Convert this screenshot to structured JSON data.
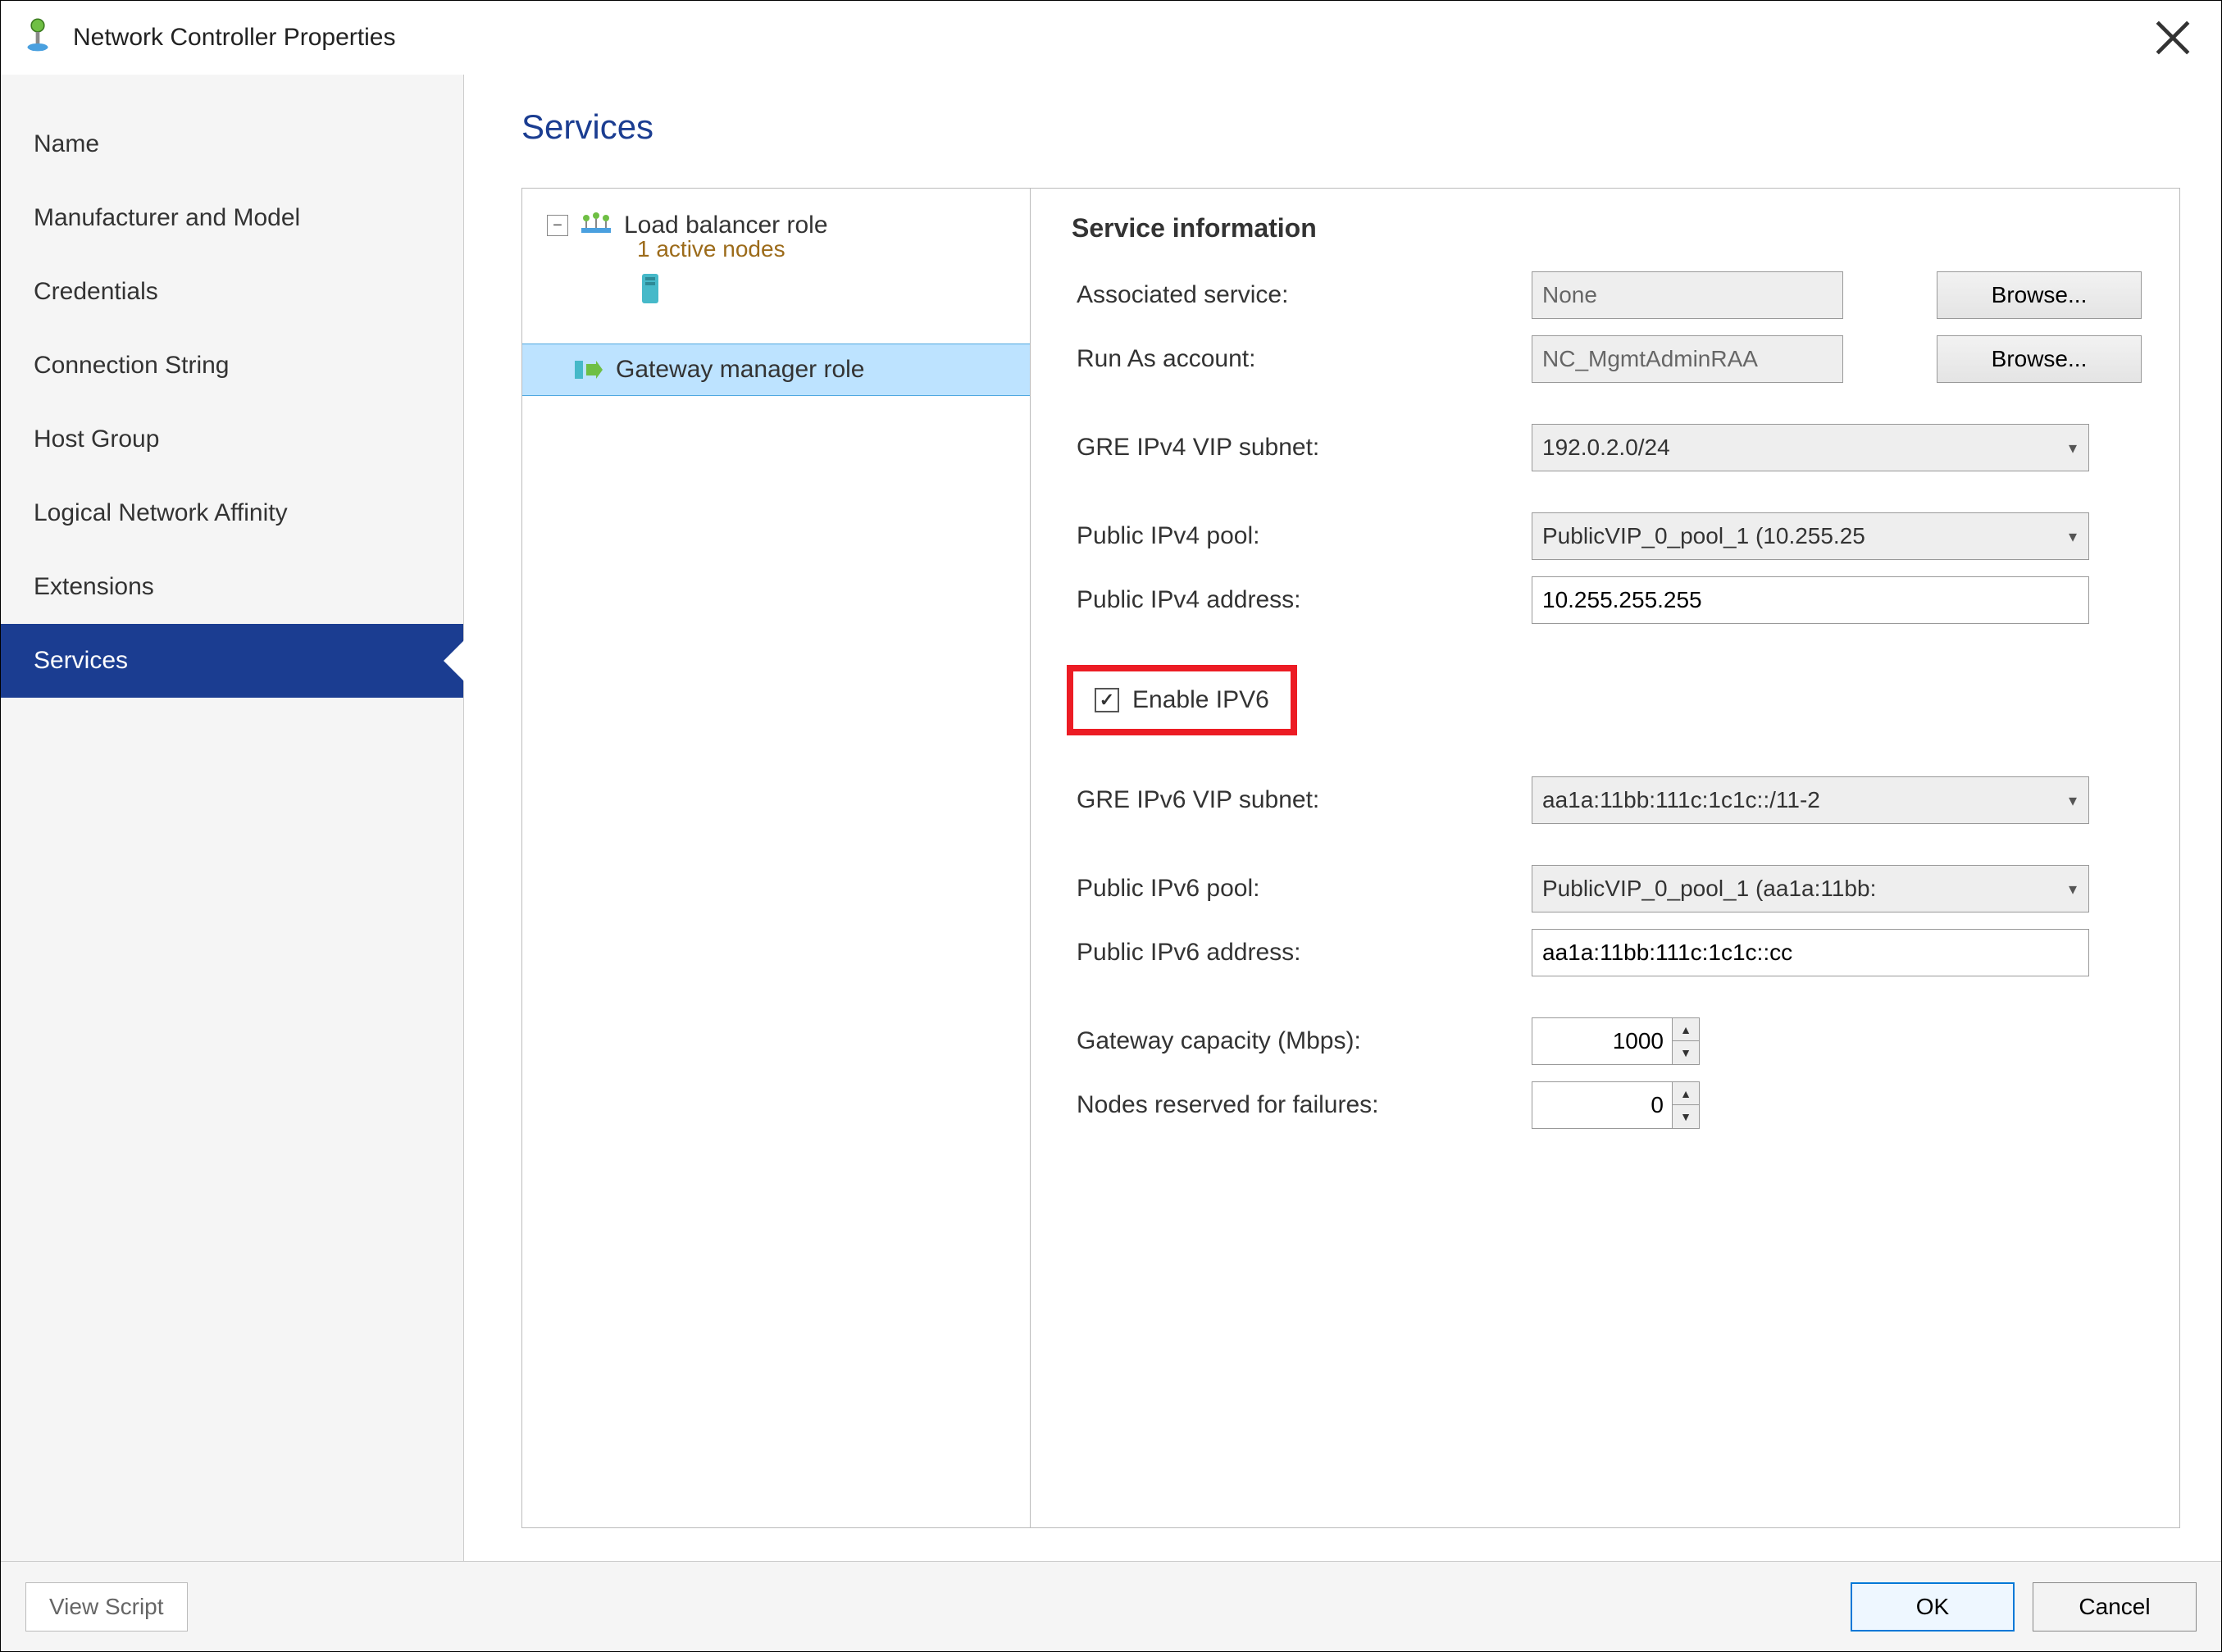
{
  "window": {
    "title": "Network Controller Properties"
  },
  "sidebar": {
    "items": [
      {
        "label": "Name"
      },
      {
        "label": "Manufacturer and Model"
      },
      {
        "label": "Credentials"
      },
      {
        "label": "Connection String"
      },
      {
        "label": "Host Group"
      },
      {
        "label": "Logical Network Affinity"
      },
      {
        "label": "Extensions"
      },
      {
        "label": "Services"
      }
    ],
    "selected": "Services"
  },
  "page": {
    "title": "Services"
  },
  "tree": {
    "expand_collapse_glyph": "−",
    "items": [
      {
        "label": "Load balancer role",
        "subtext": "1 active nodes",
        "icon": "load-balancer-icon",
        "expanded": true
      },
      {
        "label": "Gateway manager role",
        "icon": "gateway-icon",
        "selected": true
      }
    ]
  },
  "form": {
    "section_title": "Service information",
    "associated_service_label": "Associated service:",
    "associated_service_value": "None",
    "browse_label": "Browse...",
    "run_as_label": "Run As account:",
    "run_as_value": "NC_MgmtAdminRAA",
    "gre_v4_label": "GRE IPv4 VIP subnet:",
    "gre_v4_value": "192.0.2.0/24",
    "pub_v4_pool_label": "Public IPv4 pool:",
    "pub_v4_pool_value": "PublicVIP_0_pool_1 (10.255.25",
    "pub_v4_addr_label": "Public IPv4 address:",
    "pub_v4_addr_value": "10.255.255.255",
    "enable_ipv6_label": "Enable IPV6",
    "enable_ipv6_checked": true,
    "gre_v6_label": "GRE IPv6 VIP subnet:",
    "gre_v6_value": "aa1a:11bb:111c:1c1c::/11-2",
    "pub_v6_pool_label": "Public IPv6 pool:",
    "pub_v6_pool_value": "PublicVIP_0_pool_1 (aa1a:11bb:",
    "pub_v6_addr_label": "Public IPv6 address:",
    "pub_v6_addr_value": "aa1a:11bb:111c:1c1c::cc",
    "gw_capacity_label": "Gateway capacity (Mbps):",
    "gw_capacity_value": "1000",
    "nodes_reserved_label": "Nodes reserved for failures:",
    "nodes_reserved_value": "0"
  },
  "footer": {
    "view_script": "View Script",
    "ok": "OK",
    "cancel": "Cancel"
  }
}
